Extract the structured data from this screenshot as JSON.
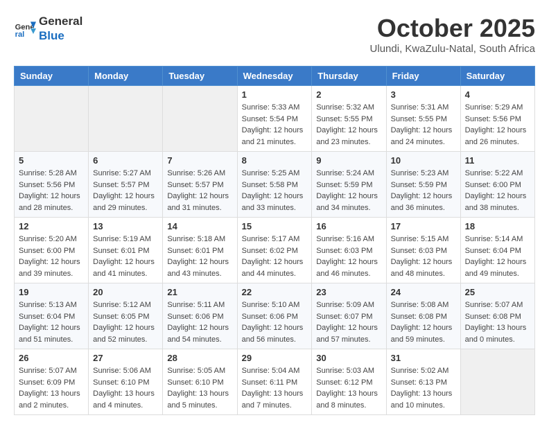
{
  "header": {
    "logo_general": "General",
    "logo_blue": "Blue",
    "month_title": "October 2025",
    "location": "Ulundi, KwaZulu-Natal, South Africa"
  },
  "days_of_week": [
    "Sunday",
    "Monday",
    "Tuesday",
    "Wednesday",
    "Thursday",
    "Friday",
    "Saturday"
  ],
  "weeks": [
    [
      {
        "day": "",
        "info": ""
      },
      {
        "day": "",
        "info": ""
      },
      {
        "day": "",
        "info": ""
      },
      {
        "day": "1",
        "info": "Sunrise: 5:33 AM\nSunset: 5:54 PM\nDaylight: 12 hours\nand 21 minutes."
      },
      {
        "day": "2",
        "info": "Sunrise: 5:32 AM\nSunset: 5:55 PM\nDaylight: 12 hours\nand 23 minutes."
      },
      {
        "day": "3",
        "info": "Sunrise: 5:31 AM\nSunset: 5:55 PM\nDaylight: 12 hours\nand 24 minutes."
      },
      {
        "day": "4",
        "info": "Sunrise: 5:29 AM\nSunset: 5:56 PM\nDaylight: 12 hours\nand 26 minutes."
      }
    ],
    [
      {
        "day": "5",
        "info": "Sunrise: 5:28 AM\nSunset: 5:56 PM\nDaylight: 12 hours\nand 28 minutes."
      },
      {
        "day": "6",
        "info": "Sunrise: 5:27 AM\nSunset: 5:57 PM\nDaylight: 12 hours\nand 29 minutes."
      },
      {
        "day": "7",
        "info": "Sunrise: 5:26 AM\nSunset: 5:57 PM\nDaylight: 12 hours\nand 31 minutes."
      },
      {
        "day": "8",
        "info": "Sunrise: 5:25 AM\nSunset: 5:58 PM\nDaylight: 12 hours\nand 33 minutes."
      },
      {
        "day": "9",
        "info": "Sunrise: 5:24 AM\nSunset: 5:59 PM\nDaylight: 12 hours\nand 34 minutes."
      },
      {
        "day": "10",
        "info": "Sunrise: 5:23 AM\nSunset: 5:59 PM\nDaylight: 12 hours\nand 36 minutes."
      },
      {
        "day": "11",
        "info": "Sunrise: 5:22 AM\nSunset: 6:00 PM\nDaylight: 12 hours\nand 38 minutes."
      }
    ],
    [
      {
        "day": "12",
        "info": "Sunrise: 5:20 AM\nSunset: 6:00 PM\nDaylight: 12 hours\nand 39 minutes."
      },
      {
        "day": "13",
        "info": "Sunrise: 5:19 AM\nSunset: 6:01 PM\nDaylight: 12 hours\nand 41 minutes."
      },
      {
        "day": "14",
        "info": "Sunrise: 5:18 AM\nSunset: 6:01 PM\nDaylight: 12 hours\nand 43 minutes."
      },
      {
        "day": "15",
        "info": "Sunrise: 5:17 AM\nSunset: 6:02 PM\nDaylight: 12 hours\nand 44 minutes."
      },
      {
        "day": "16",
        "info": "Sunrise: 5:16 AM\nSunset: 6:03 PM\nDaylight: 12 hours\nand 46 minutes."
      },
      {
        "day": "17",
        "info": "Sunrise: 5:15 AM\nSunset: 6:03 PM\nDaylight: 12 hours\nand 48 minutes."
      },
      {
        "day": "18",
        "info": "Sunrise: 5:14 AM\nSunset: 6:04 PM\nDaylight: 12 hours\nand 49 minutes."
      }
    ],
    [
      {
        "day": "19",
        "info": "Sunrise: 5:13 AM\nSunset: 6:04 PM\nDaylight: 12 hours\nand 51 minutes."
      },
      {
        "day": "20",
        "info": "Sunrise: 5:12 AM\nSunset: 6:05 PM\nDaylight: 12 hours\nand 52 minutes."
      },
      {
        "day": "21",
        "info": "Sunrise: 5:11 AM\nSunset: 6:06 PM\nDaylight: 12 hours\nand 54 minutes."
      },
      {
        "day": "22",
        "info": "Sunrise: 5:10 AM\nSunset: 6:06 PM\nDaylight: 12 hours\nand 56 minutes."
      },
      {
        "day": "23",
        "info": "Sunrise: 5:09 AM\nSunset: 6:07 PM\nDaylight: 12 hours\nand 57 minutes."
      },
      {
        "day": "24",
        "info": "Sunrise: 5:08 AM\nSunset: 6:08 PM\nDaylight: 12 hours\nand 59 minutes."
      },
      {
        "day": "25",
        "info": "Sunrise: 5:07 AM\nSunset: 6:08 PM\nDaylight: 13 hours\nand 0 minutes."
      }
    ],
    [
      {
        "day": "26",
        "info": "Sunrise: 5:07 AM\nSunset: 6:09 PM\nDaylight: 13 hours\nand 2 minutes."
      },
      {
        "day": "27",
        "info": "Sunrise: 5:06 AM\nSunset: 6:10 PM\nDaylight: 13 hours\nand 4 minutes."
      },
      {
        "day": "28",
        "info": "Sunrise: 5:05 AM\nSunset: 6:10 PM\nDaylight: 13 hours\nand 5 minutes."
      },
      {
        "day": "29",
        "info": "Sunrise: 5:04 AM\nSunset: 6:11 PM\nDaylight: 13 hours\nand 7 minutes."
      },
      {
        "day": "30",
        "info": "Sunrise: 5:03 AM\nSunset: 6:12 PM\nDaylight: 13 hours\nand 8 minutes."
      },
      {
        "day": "31",
        "info": "Sunrise: 5:02 AM\nSunset: 6:13 PM\nDaylight: 13 hours\nand 10 minutes."
      },
      {
        "day": "",
        "info": ""
      }
    ]
  ]
}
